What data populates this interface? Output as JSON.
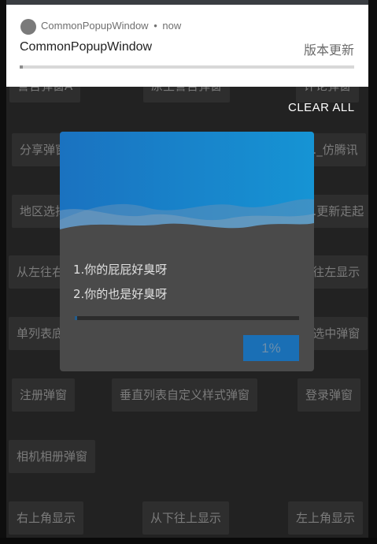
{
  "notification": {
    "app_name": "CommonPopupWindow",
    "separator": "•",
    "time": "now",
    "title": "CommonPopupWindow",
    "text": "版本更新",
    "progress": 0.01
  },
  "clear_all": "CLEAR ALL",
  "buttons": {
    "alert_a": "警告弹窗A",
    "native_alert": "原生警告弹窗",
    "comment": "评论弹窗",
    "share": "分享弹窗",
    "tencent": "..._仿腾讯",
    "region": "地区选择",
    "update": "...更新走起",
    "left_to_right": "从左往右",
    "right_to_left": "...往左显示",
    "single_list": "单列表底",
    "select_dialog": "...选中弹窗",
    "register": "注册弹窗",
    "vertical_list_custom": "垂直列表自定义样式弹窗",
    "login": "登录弹窗",
    "camera_album": "相机相册弹窗",
    "top_right": "右上角显示",
    "bottom_to_top": "从下往上显示",
    "top_left": "左上角显示"
  },
  "dialog": {
    "line1": "1.你的屁屁好臭呀",
    "line2": "2.你的也是好臭呀",
    "progress": 0.01,
    "percent_label": "1%"
  },
  "colors": {
    "header_gradient_left": "#1a72c0",
    "header_gradient_right": "#1694d4",
    "accent": "#1a6fb5"
  }
}
